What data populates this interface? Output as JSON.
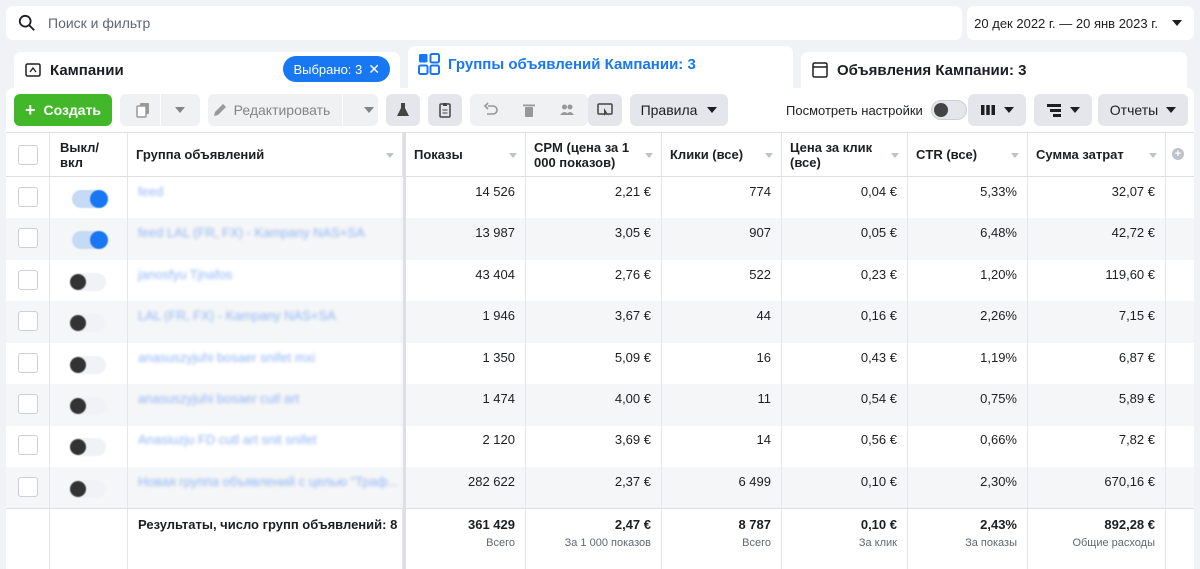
{
  "search": {
    "placeholder": "Поиск и фильтр"
  },
  "date_range": "20 дек 2022 г. — 20 янв 2023 г.",
  "tabs": {
    "campaigns": "Кампании",
    "selected": "Выбрано: 3",
    "adsets": "Группы объявлений Кампании: 3",
    "ads": "Объявления Кампании: 3"
  },
  "toolbar": {
    "create": "Создать",
    "edit": "Редактировать",
    "rules": "Правила",
    "view_settings": "Посмотреть настройки",
    "reports": "Отчеты"
  },
  "columns": {
    "toggle": "Выкл/\nвкл",
    "name": "Группа объявлений",
    "impressions": "Показы",
    "cpm": "CPM (цена за 1 000 показов)",
    "clicks": "Клики (все)",
    "cpc": "Цена за клик (все)",
    "ctr": "CTR (все)",
    "spend": "Сумма затрат"
  },
  "rows": [
    {
      "name": "feed",
      "on": true,
      "impressions": "14 526",
      "cpm": "2,21 €",
      "clicks": "774",
      "cpc": "0,04 €",
      "ctr": "5,33%",
      "spend": "32,07 €"
    },
    {
      "name": "feed LAL (FR, FX) - Kampany NAS+SA",
      "on": true,
      "impressions": "13 987",
      "cpm": "3,05 €",
      "clicks": "907",
      "cpc": "0,05 €",
      "ctr": "6,48%",
      "spend": "42,72 €"
    },
    {
      "name": "janosfyu Tjnafos",
      "on": false,
      "impressions": "43 404",
      "cpm": "2,76 €",
      "clicks": "522",
      "cpc": "0,23 €",
      "ctr": "1,20%",
      "spend": "119,60 €"
    },
    {
      "name": "LAL (FR, FX) - Kampany NAS+SA",
      "on": false,
      "impressions": "1 946",
      "cpm": "3,67 €",
      "clicks": "44",
      "cpc": "0,16 €",
      "ctr": "2,26%",
      "spend": "7,15 €"
    },
    {
      "name": "anasuszyjuhi bosaer snifet mxi",
      "on": false,
      "impressions": "1 350",
      "cpm": "5,09 €",
      "clicks": "16",
      "cpc": "0,43 €",
      "ctr": "1,19%",
      "spend": "6,87 €"
    },
    {
      "name": "anasuszyjuhi bosaer cutl art",
      "on": false,
      "impressions": "1 474",
      "cpm": "4,00 €",
      "clicks": "11",
      "cpc": "0,54 €",
      "ctr": "0,75%",
      "spend": "5,89 €"
    },
    {
      "name": "Anasiuzju FD cutl art snit snifet",
      "on": false,
      "impressions": "2 120",
      "cpm": "3,69 €",
      "clicks": "14",
      "cpc": "0,56 €",
      "ctr": "0,66%",
      "spend": "7,82 €"
    },
    {
      "name": "Новая группа объявлений с целью \"Траф...",
      "on": false,
      "impressions": "282 622",
      "cpm": "2,37 €",
      "clicks": "6 499",
      "cpc": "0,10 €",
      "ctr": "2,30%",
      "spend": "670,16 €"
    }
  ],
  "totals": {
    "label": "Результаты, число групп объявлений: 8",
    "impressions": "361 429",
    "impressions_sub": "Всего",
    "cpm": "2,47 €",
    "cpm_sub": "За 1 000 показов",
    "clicks": "8 787",
    "clicks_sub": "Всего",
    "cpc": "0,10 €",
    "cpc_sub": "За клик",
    "ctr": "2,43%",
    "ctr_sub": "За показы",
    "spend": "892,28 €",
    "spend_sub": "Общие расходы"
  },
  "colors": {
    "accent": "#1877f2",
    "create": "#42b72a"
  }
}
